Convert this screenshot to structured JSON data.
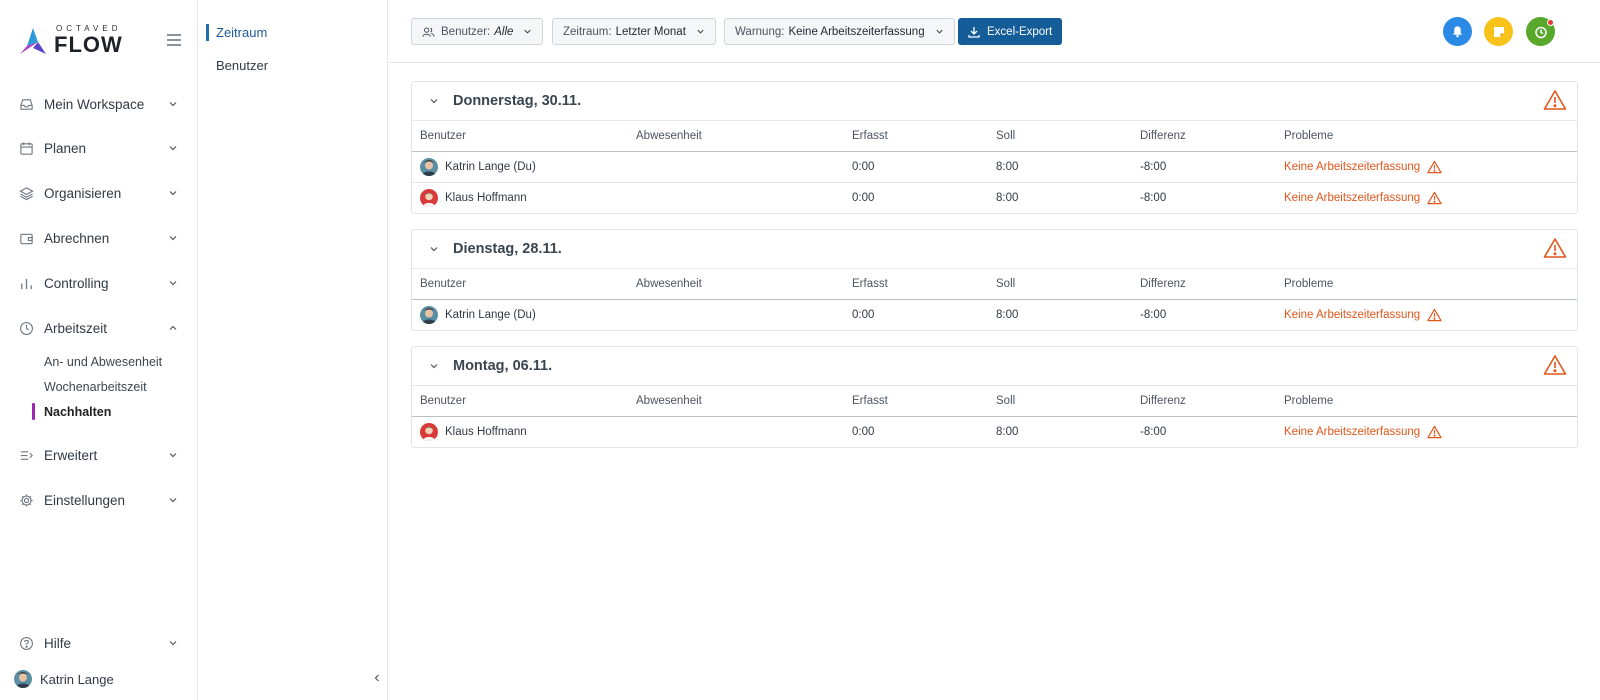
{
  "brand": {
    "small": "OCTAVED",
    "big": "FLOW"
  },
  "sidebar": {
    "items": [
      {
        "label": "Mein Workspace",
        "icon": "inbox-icon"
      },
      {
        "label": "Planen",
        "icon": "calendar-icon"
      },
      {
        "label": "Organisieren",
        "icon": "layers-icon"
      },
      {
        "label": "Abrechnen",
        "icon": "wallet-icon"
      },
      {
        "label": "Controlling",
        "icon": "bar-chart-icon"
      },
      {
        "label": "Arbeitszeit",
        "icon": "clock-icon"
      },
      {
        "label": "Erweitert",
        "icon": "list-arrow-icon"
      },
      {
        "label": "Einstellungen",
        "icon": "gear-icon"
      },
      {
        "label": "Hilfe",
        "icon": "help-icon"
      }
    ],
    "sub_items": [
      "An- und Abwesenheit",
      "Wochenarbeitszeit",
      "Nachhalten"
    ],
    "active_sub": "Nachhalten",
    "user": "Katrin Lange"
  },
  "subnav": {
    "items": [
      "Zeitraum",
      "Benutzer"
    ],
    "active": "Zeitraum"
  },
  "toolbar": {
    "filters": [
      {
        "key": "Benutzer:",
        "value": "Alle",
        "icon": "users-icon"
      },
      {
        "key": "Zeitraum:",
        "value": "Letzter Monat"
      },
      {
        "key": "Warnung:",
        "value": "Keine Arbeitszeiterfassung"
      }
    ],
    "export_label": "Excel-Export",
    "colors": {
      "notify": "#2b8ae5",
      "notes": "#f8c21a",
      "timer": "#57a82b",
      "accent": "#145d99",
      "warning": "#e0561b"
    }
  },
  "columns": [
    "Benutzer",
    "Abwesenheit",
    "Erfasst",
    "Soll",
    "Differenz",
    "Probleme"
  ],
  "groups": [
    {
      "title": "Donnerstag, 30.11.",
      "rows": [
        {
          "user": "Katrin Lange (Du)",
          "absence": "",
          "recorded": "0:00",
          "target": "8:00",
          "diff": "-8:00",
          "problem": "Keine Arbeitszeiterfassung",
          "avatar": "katrin"
        },
        {
          "user": "Klaus Hoffmann",
          "absence": "",
          "recorded": "0:00",
          "target": "8:00",
          "diff": "-8:00",
          "problem": "Keine Arbeitszeiterfassung",
          "avatar": "klaus"
        }
      ]
    },
    {
      "title": "Dienstag, 28.11.",
      "rows": [
        {
          "user": "Katrin Lange (Du)",
          "absence": "",
          "recorded": "0:00",
          "target": "8:00",
          "diff": "-8:00",
          "problem": "Keine Arbeitszeiterfassung",
          "avatar": "katrin"
        }
      ]
    },
    {
      "title": "Montag, 06.11.",
      "rows": [
        {
          "user": "Klaus Hoffmann",
          "absence": "",
          "recorded": "0:00",
          "target": "8:00",
          "diff": "-8:00",
          "problem": "Keine Arbeitszeiterfassung",
          "avatar": "klaus"
        }
      ]
    }
  ]
}
